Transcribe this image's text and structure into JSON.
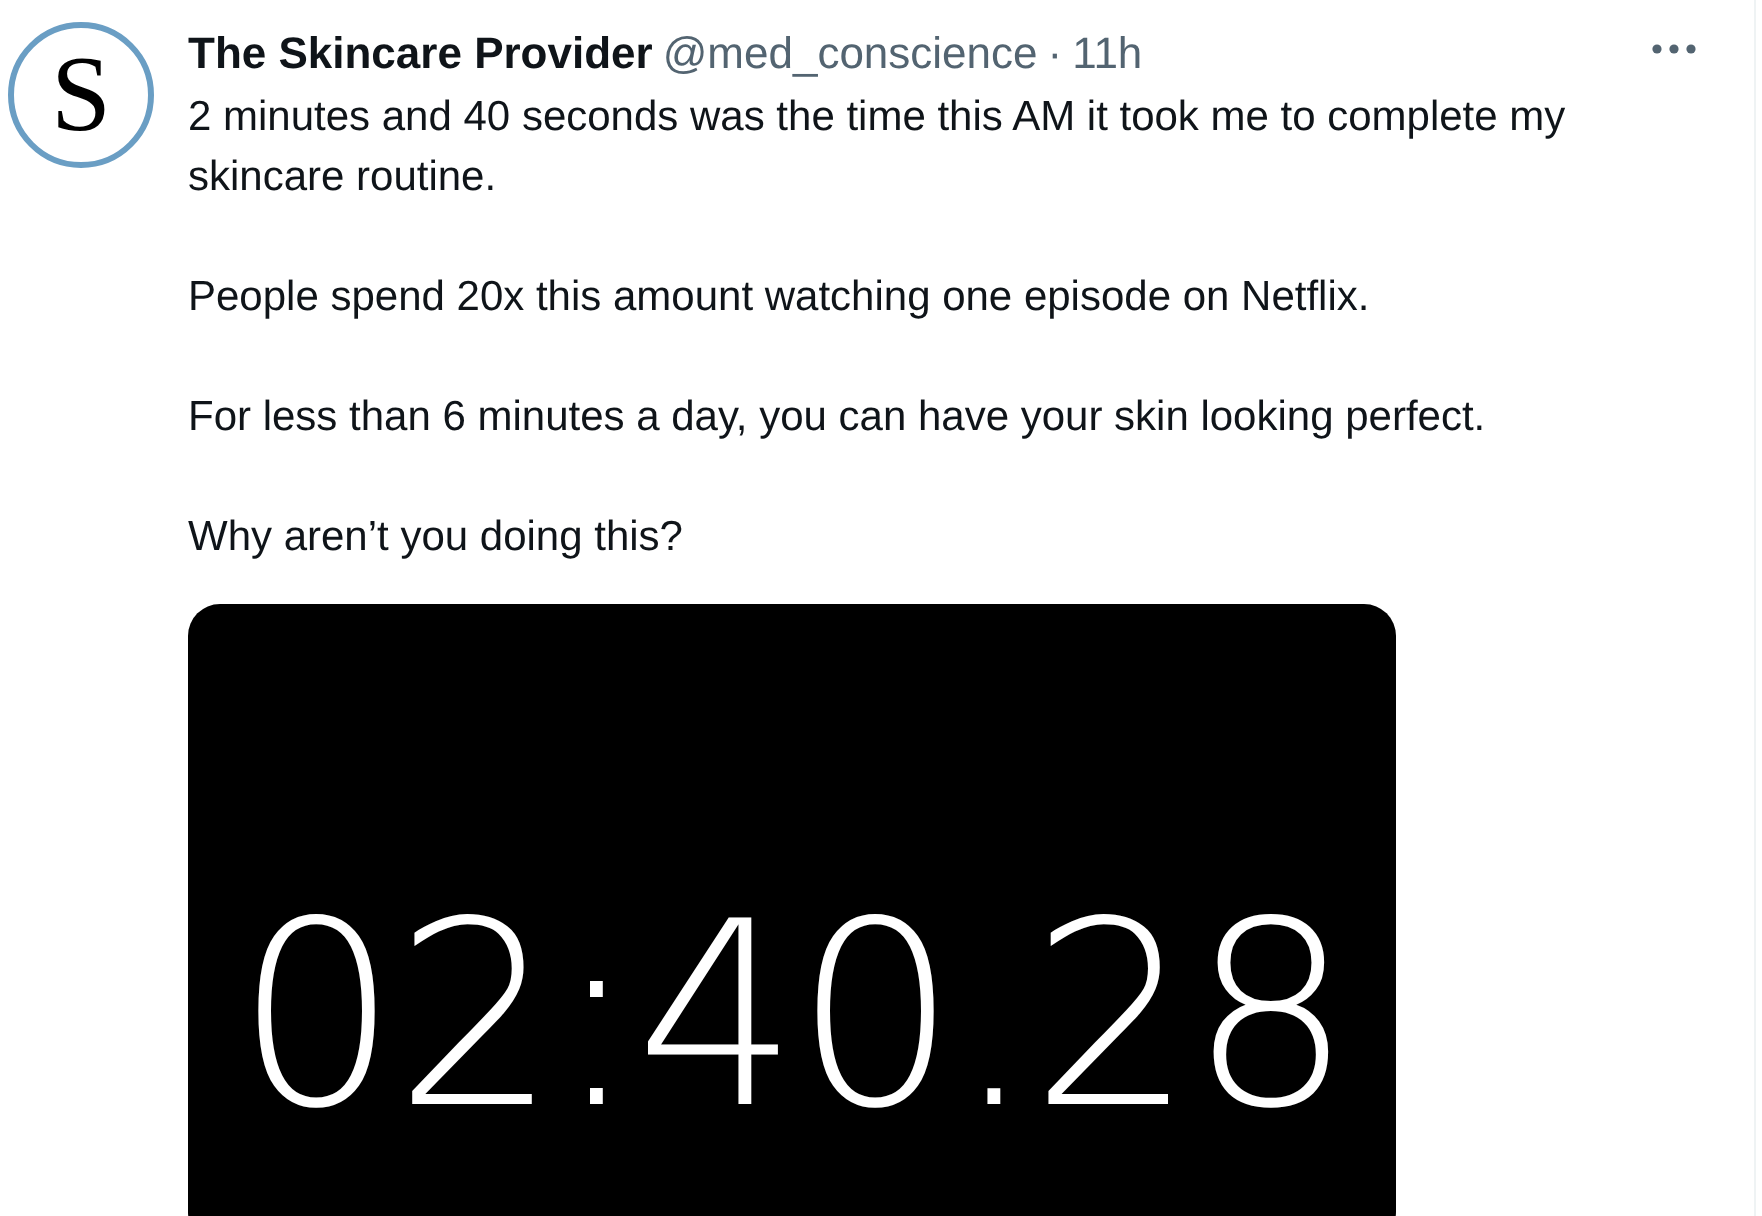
{
  "tweet": {
    "avatar_text": "S",
    "author_name": "The Skincare Provider",
    "handle": "@med_conscience",
    "separator": "·",
    "time": "11h",
    "paragraphs": [
      "2 minutes and 40 seconds was the time this AM it took me to complete my skincare routine.",
      "People spend 20x this amount watching one episode on Netflix.",
      "For less than 6 minutes a day, you can have your skin looking perfect.",
      "Why aren’t you doing this?"
    ],
    "media": {
      "kind": "stopwatch-screenshot",
      "display": "02:40.28"
    }
  }
}
